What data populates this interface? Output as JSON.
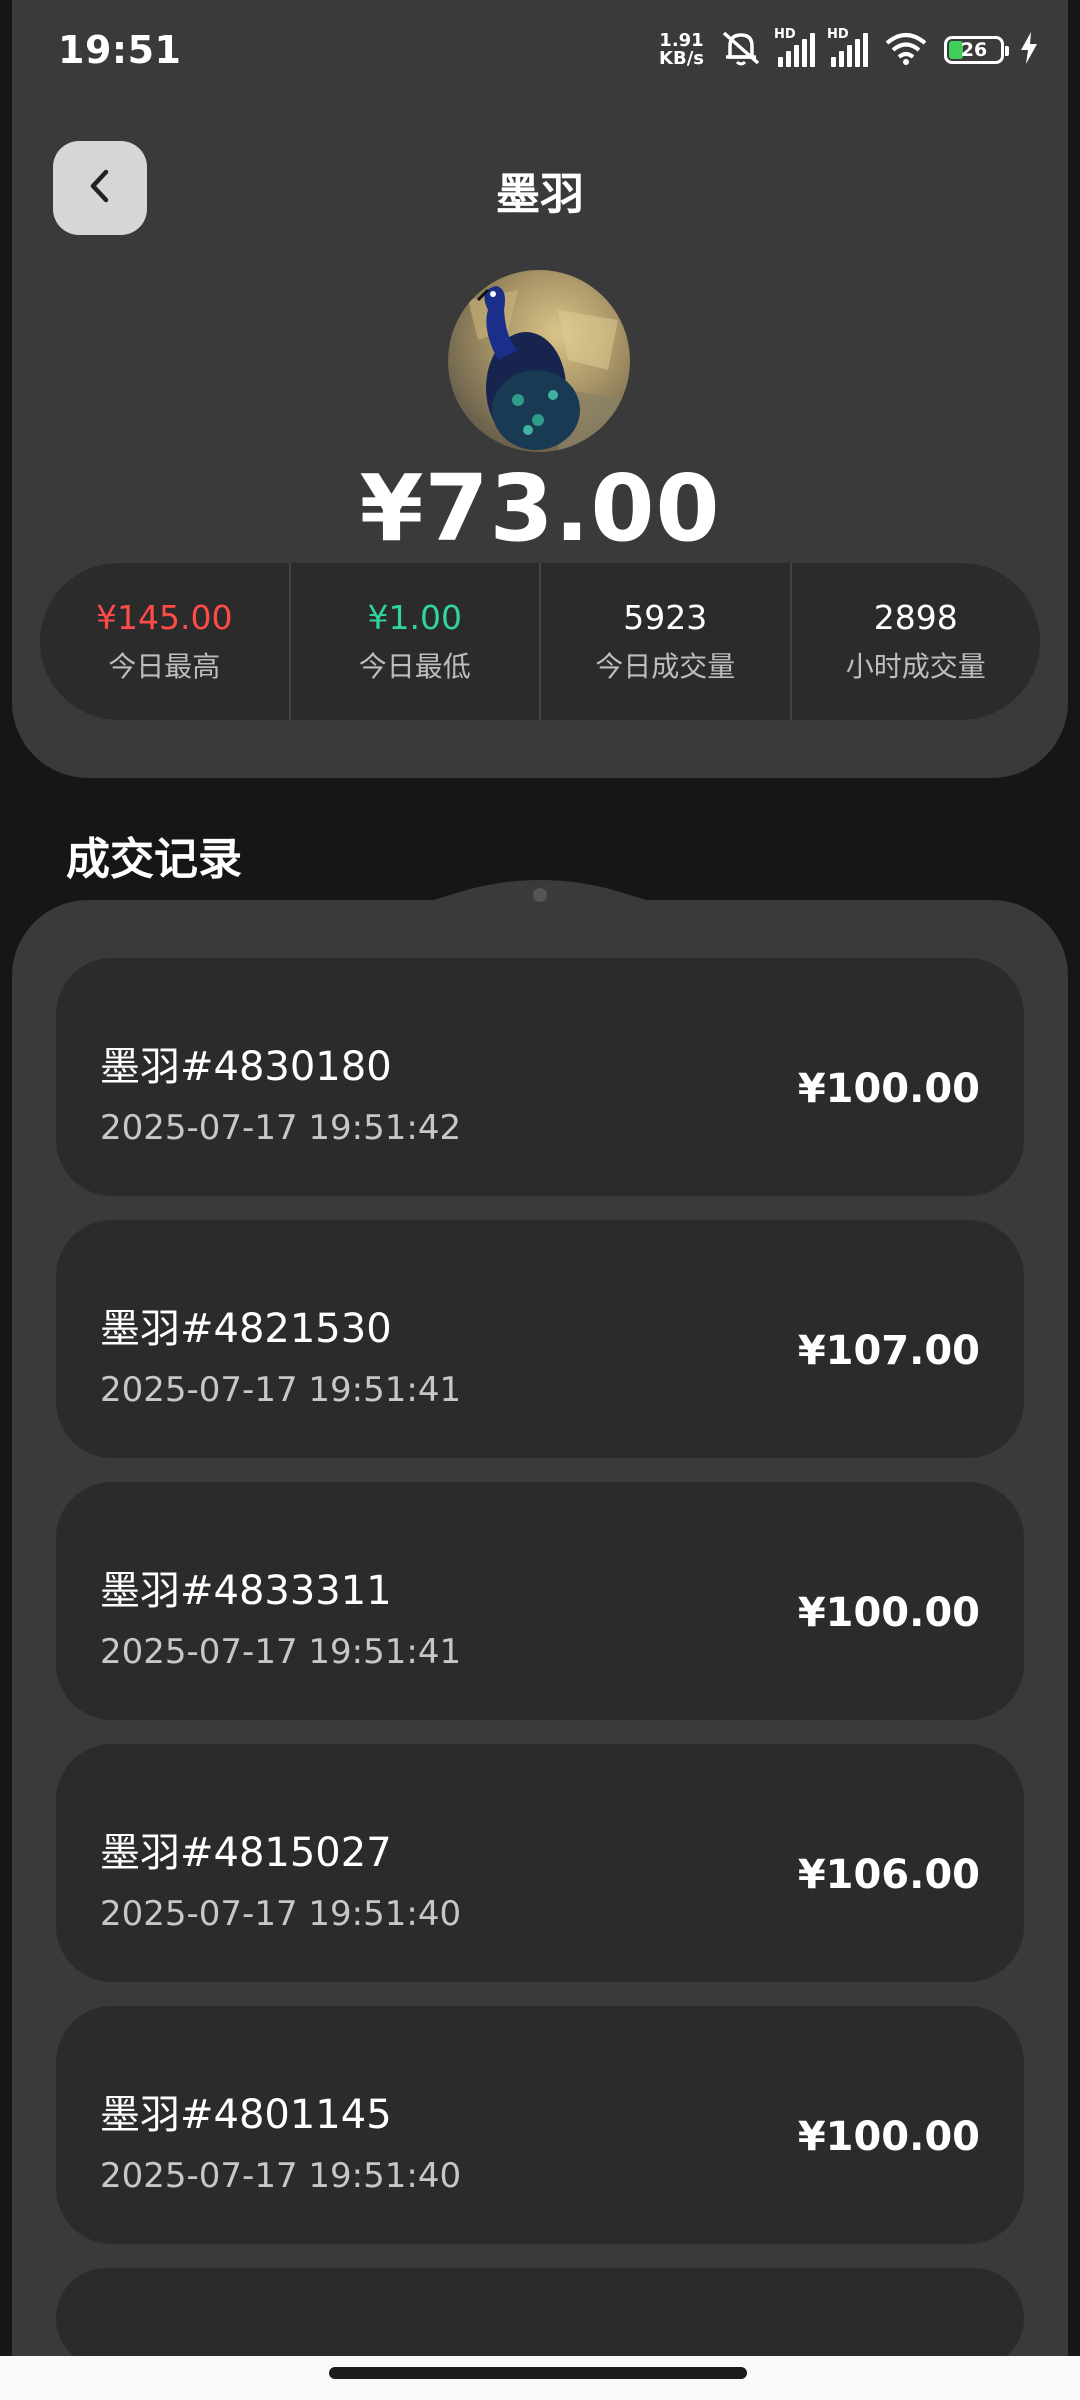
{
  "status_bar": {
    "time": "19:51",
    "net_speed_value": "1.91",
    "net_speed_unit": "KB/s",
    "hd_label": "HD",
    "battery": "26"
  },
  "header": {
    "title": "墨羽",
    "price": "¥73.00",
    "stats": [
      {
        "value": "¥145.00",
        "label": "今日最高"
      },
      {
        "value": "¥1.00",
        "label": "今日最低"
      },
      {
        "value": "5923",
        "label": "今日成交量"
      },
      {
        "value": "2898",
        "label": "小时成交量"
      }
    ]
  },
  "records": {
    "title": "成交记录",
    "items": [
      {
        "name": "墨羽#4830180",
        "time": "2025-07-17 19:51:42",
        "price": "¥100.00"
      },
      {
        "name": "墨羽#4821530",
        "time": "2025-07-17 19:51:41",
        "price": "¥107.00"
      },
      {
        "name": "墨羽#4833311",
        "time": "2025-07-17 19:51:41",
        "price": "¥100.00"
      },
      {
        "name": "墨羽#4815027",
        "time": "2025-07-17 19:51:40",
        "price": "¥106.00"
      },
      {
        "name": "墨羽#4801145",
        "time": "2025-07-17 19:51:40",
        "price": "¥100.00"
      }
    ]
  },
  "colors": {
    "background": "#161616",
    "card": "#3a3a3a",
    "inner_card": "#2b2b2b",
    "high": "#ff4a4a",
    "low": "#2fd59a"
  }
}
